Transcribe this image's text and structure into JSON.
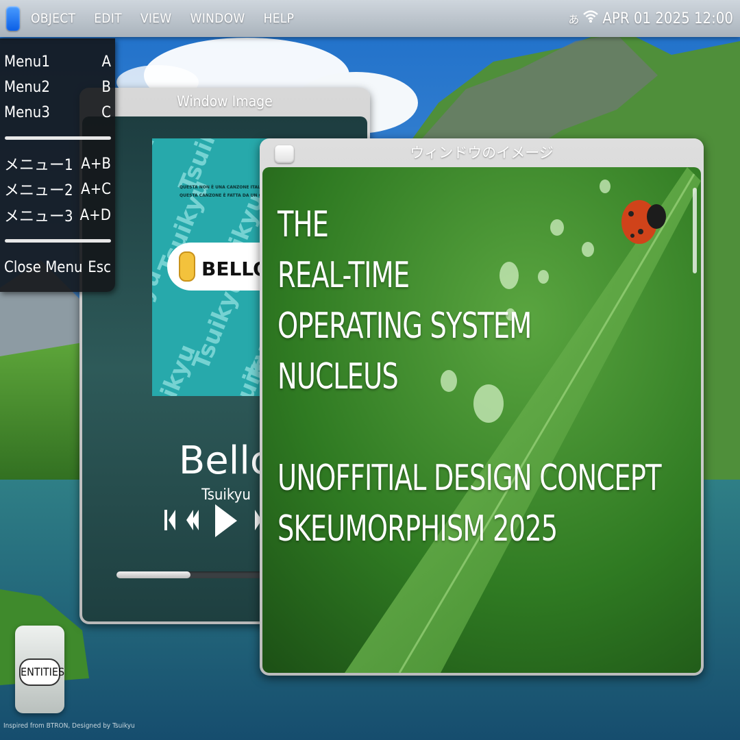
{
  "menubar": {
    "menus": [
      "OBJECT",
      "EDIT",
      "VIEW",
      "WINDOW",
      "HELP"
    ],
    "ime_indicator": "あ",
    "datetime": "APR 01 2025 12:00"
  },
  "dropdown": {
    "items": [
      {
        "label": "Menu1",
        "shortcut": "A"
      },
      {
        "label": "Menu2",
        "shortcut": "B"
      },
      {
        "label": "Menu3",
        "shortcut": "C"
      },
      {
        "label": "メニュー1",
        "shortcut": "A+B"
      },
      {
        "label": "メニュー2",
        "shortcut": "A+C"
      },
      {
        "label": "メニュー3",
        "shortcut": "A+D"
      },
      {
        "label": "Close Menu",
        "shortcut": "Esc"
      }
    ]
  },
  "player_window": {
    "title": "Window Image",
    "album": {
      "caption_line1": "QUESTA NON È UNA CANZONE ITALIANA.",
      "caption_line2": "QUESTA CANZONE È FATTA DA UN GIAPPONESE.",
      "badge": "BELLO!",
      "pattern_text": "Tsuikyu"
    },
    "song_title": "Bello",
    "artist": "Tsuikyu",
    "progress": 0.3
  },
  "image_window": {
    "title": "ウィンドウのイメージ",
    "headline": [
      "THE",
      "REAL-TIME",
      "OPERATING SYSTEM",
      "NUCLEUS",
      "",
      "UNOFFITIAL DESIGN CONCEPT",
      "SKEUMORPHISM 2025"
    ]
  },
  "desktop": {
    "icon_label": "ENTITIES",
    "credits": "Inspired from BTRON, Designed by Tsuikyu"
  },
  "colors": {
    "menubar": "#b8c0c8",
    "accent_button": "#1a6ff0",
    "leaf_green": "#3f8f2e"
  }
}
